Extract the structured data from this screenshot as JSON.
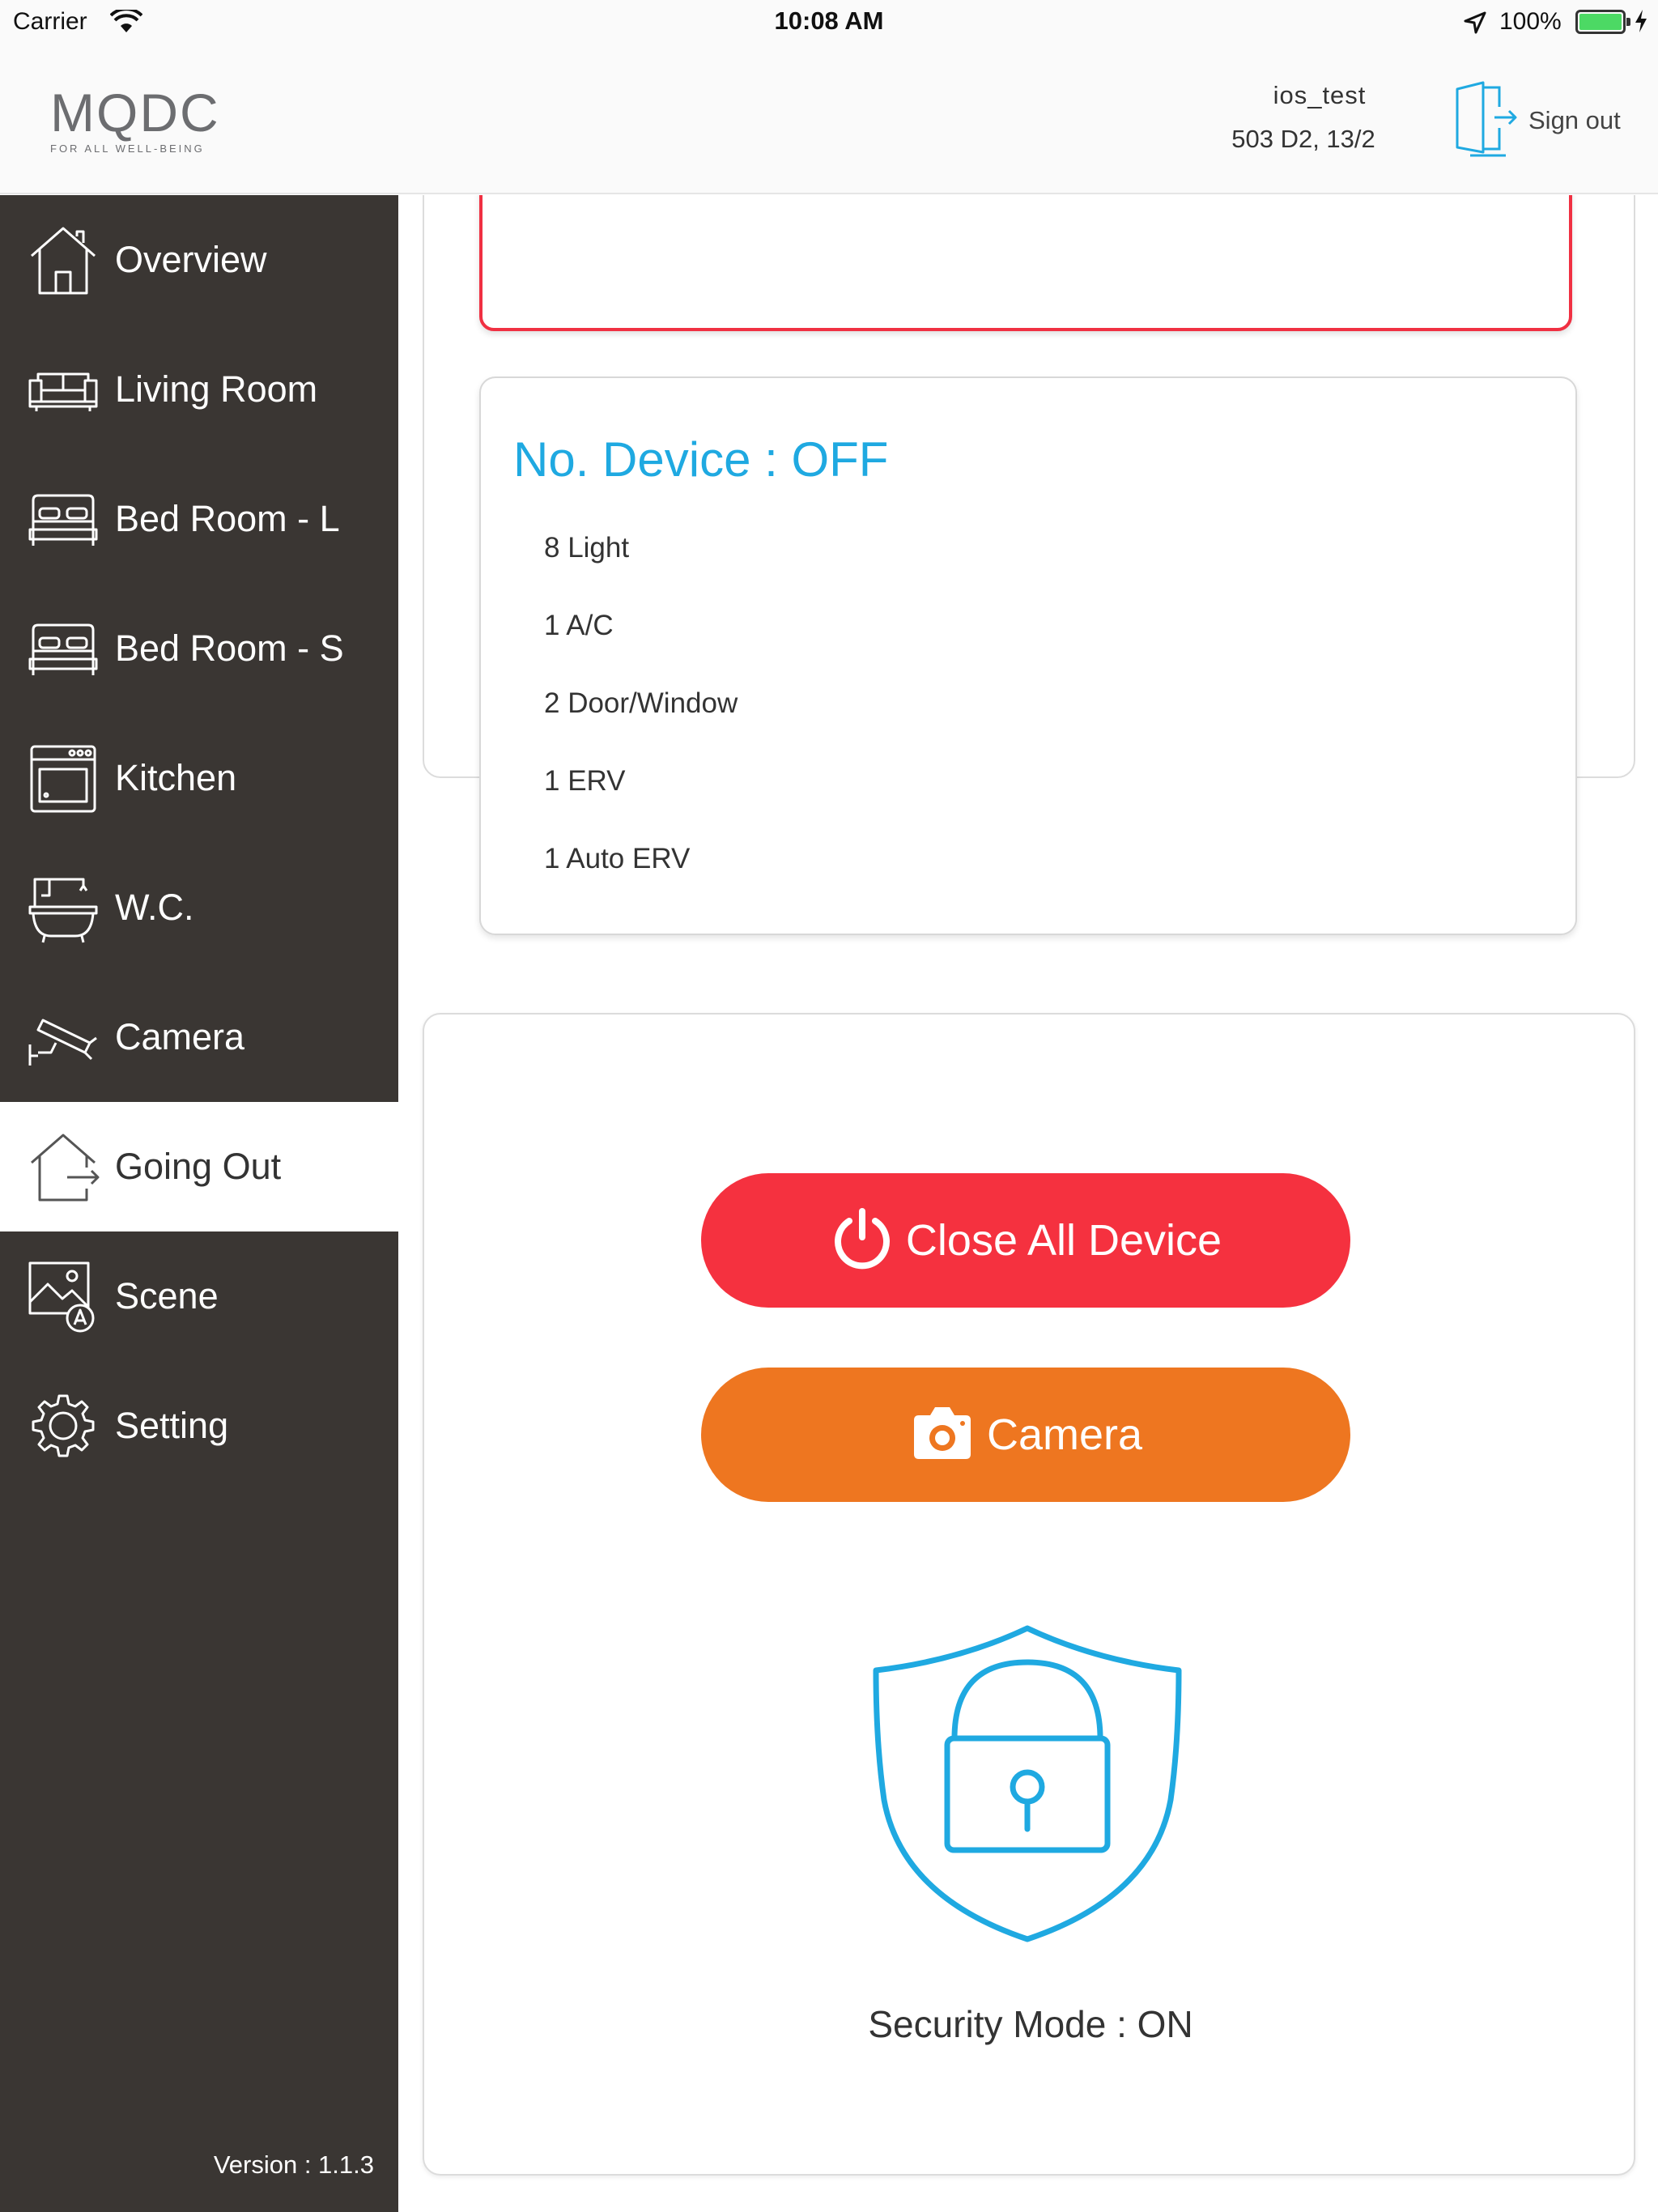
{
  "status_bar": {
    "carrier": "Carrier",
    "time": "10:08 AM",
    "battery_percent": "100%"
  },
  "header": {
    "logo_text": "MQDC",
    "logo_tagline": "FOR ALL WELL-BEING",
    "username": "ios_test",
    "unit": "503 D2, 13/2",
    "signout_label": "Sign out"
  },
  "sidebar": {
    "items": [
      {
        "label": "Overview",
        "icon": "home-icon"
      },
      {
        "label": "Living Room",
        "icon": "sofa-icon"
      },
      {
        "label": "Bed Room - L",
        "icon": "bed-icon"
      },
      {
        "label": "Bed Room - S",
        "icon": "bed-icon"
      },
      {
        "label": "Kitchen",
        "icon": "oven-icon"
      },
      {
        "label": "W.C.",
        "icon": "bathtub-icon"
      },
      {
        "label": "Camera",
        "icon": "cctv-icon"
      },
      {
        "label": "Going Out",
        "icon": "going-out-icon",
        "active": true
      },
      {
        "label": "Scene",
        "icon": "scene-icon"
      },
      {
        "label": "Setting",
        "icon": "gear-icon"
      }
    ],
    "version": "Version : 1.1.3"
  },
  "device_card": {
    "title": "No. Device : OFF",
    "items": [
      "8 Light",
      "1 A/C",
      "2 Door/Window",
      "1 ERV",
      "1 Auto ERV"
    ]
  },
  "actions": {
    "close_all_label": "Close All Device",
    "camera_label": "Camera",
    "security_mode": "Security Mode : ON"
  },
  "colors": {
    "sidebar_bg": "#3a3633",
    "accent_blue": "#1fa9e1",
    "close_red": "#f5313f",
    "camera_orange": "#ee7620"
  }
}
